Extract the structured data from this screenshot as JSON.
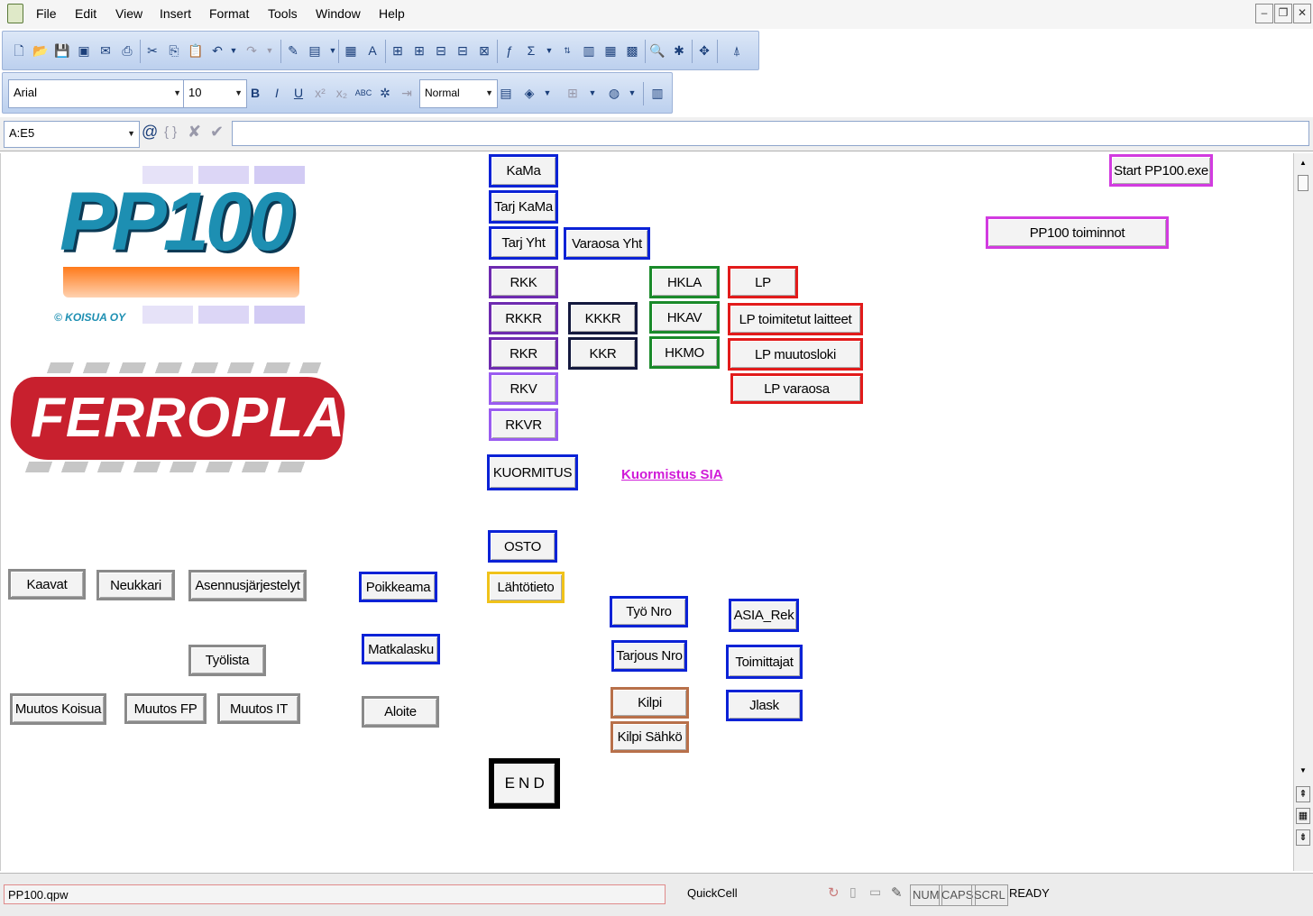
{
  "menu": [
    "File",
    "Edit",
    "View",
    "Insert",
    "Format",
    "Tools",
    "Window",
    "Help"
  ],
  "toolbar": {
    "font_name": "Arial",
    "font_size": "10",
    "style": "Normal"
  },
  "formula": {
    "cell_ref": "A:E5",
    "at_symbol": "@",
    "braces": "{ }",
    "content": ""
  },
  "logos": {
    "pp100": "PP100",
    "copyright": "© KOISUA OY",
    "ferroplan": "FERROPLAN"
  },
  "buttons": {
    "kama": "KaMa",
    "tarj_kama": "Tarj KaMa",
    "tarj_yht": "Tarj Yht",
    "varaosa_yht": "Varaosa Yht",
    "rkk": "RKK",
    "rkkr": "RKKR",
    "rkr": "RKR",
    "rkv": "RKV",
    "rkvr": "RKVR",
    "kkkr": "KKKR",
    "kkr": "KKR",
    "hkla": "HKLA",
    "hkav": "HKAV",
    "hkmo": "HKMO",
    "lp": "LP",
    "lp_toimitetut": "LP toimitetut laitteet",
    "lp_muutosloki": "LP muutosloki",
    "lp_varaosa": "LP varaosa",
    "kuormitus": "KUORMITUS",
    "osto": "OSTO",
    "lahtotieto": "Lähtötieto",
    "tyo_nro": "Työ Nro",
    "tarjous_nro": "Tarjous Nro",
    "kilpi": "Kilpi",
    "kilpi_sahko": "Kilpi Sähkö",
    "asia_rek": "ASIA_Rek",
    "toimittajat": "Toimittajat",
    "jlask": "Jlask",
    "end": "E N D",
    "kaavat": "Kaavat",
    "neukkari": "Neukkari",
    "asennus": "Asennusjärjestelyt",
    "poikkeama": "Poikkeama",
    "matkalasku": "Matkalasku",
    "tyolista": "Työlista",
    "muutos_koisua": "Muutos Koisua",
    "muutos_fp": "Muutos FP",
    "muutos_it": "Muutos IT",
    "aloite": "Aloite",
    "start_pp100": "Start PP100.exe",
    "pp100_toiminnot": "PP100 toiminnot"
  },
  "links": {
    "kuormistus_sia": "Kuormistus SIA"
  },
  "status": {
    "filename": "PP100.qpw",
    "quickcell": "QuickCell",
    "num": "NUM",
    "caps": "CAPS",
    "scrl": "SCRL",
    "mode": "READY"
  }
}
